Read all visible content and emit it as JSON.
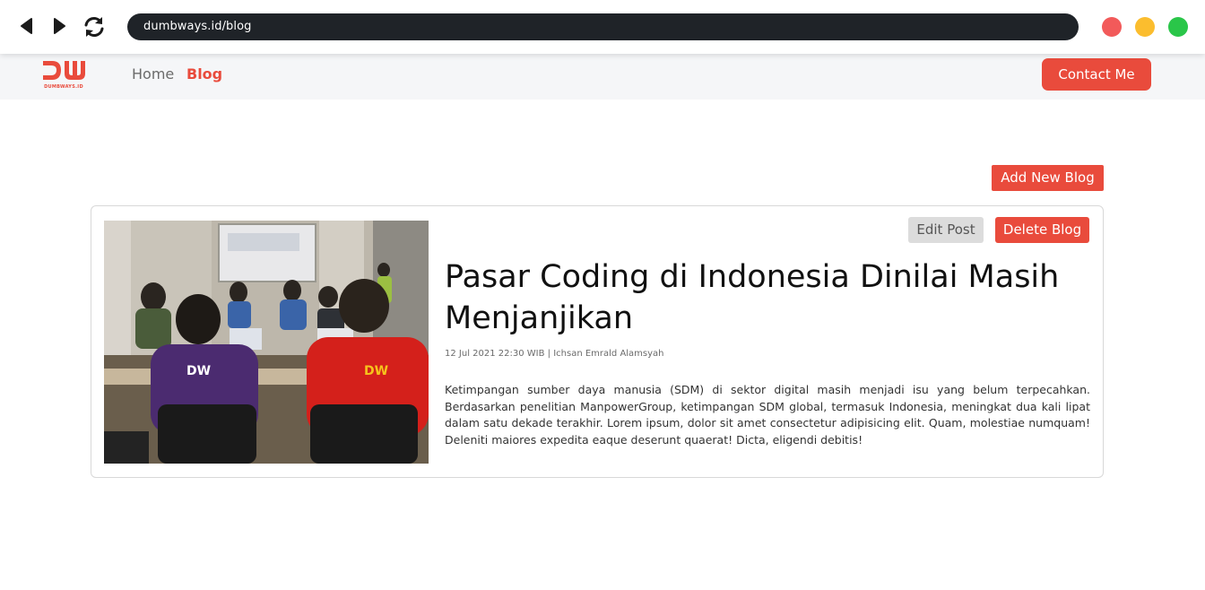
{
  "browser": {
    "url": "dumbways.id/blog",
    "icons": {
      "back": "back-arrow-icon",
      "forward": "forward-arrow-icon",
      "reload": "reload-icon"
    },
    "window_controls": [
      "#f25a5a",
      "#fbbd2e",
      "#2ac649"
    ]
  },
  "header": {
    "logo_text": "DW",
    "logo_subtext": "DUMBWAYS.ID",
    "nav": {
      "home": "Home",
      "blog": "Blog"
    },
    "contact_label": "Contact Me"
  },
  "content": {
    "add_blog_label": "Add New Blog",
    "post": {
      "edit_label": "Edit Post",
      "delete_label": "Delete Blog",
      "title": "Pasar Coding di Indonesia Dinilai Masih Menjanjikan",
      "meta": "12 Jul 2021 22:30 WIB | Ichsan Emrald Alamsyah",
      "excerpt": "Ketimpangan sumber daya manusia (SDM) di sektor digital masih menjadi isu yang belum terpecahkan. Berdasarkan penelitian ManpowerGroup, ketimpangan SDM global, termasuk Indonesia, meningkat dua kali lipat dalam satu dekade terakhir. Lorem ipsum, dolor sit amet consectetur adipisicing elit. Quam, molestiae numquam! Deleniti maiores expedita eaque deserunt quaerat! Dicta, eligendi debitis!"
    }
  },
  "colors": {
    "accent": "#e94b3c",
    "url_bar": "#1f2328",
    "header_bg": "#f5f6f8"
  }
}
